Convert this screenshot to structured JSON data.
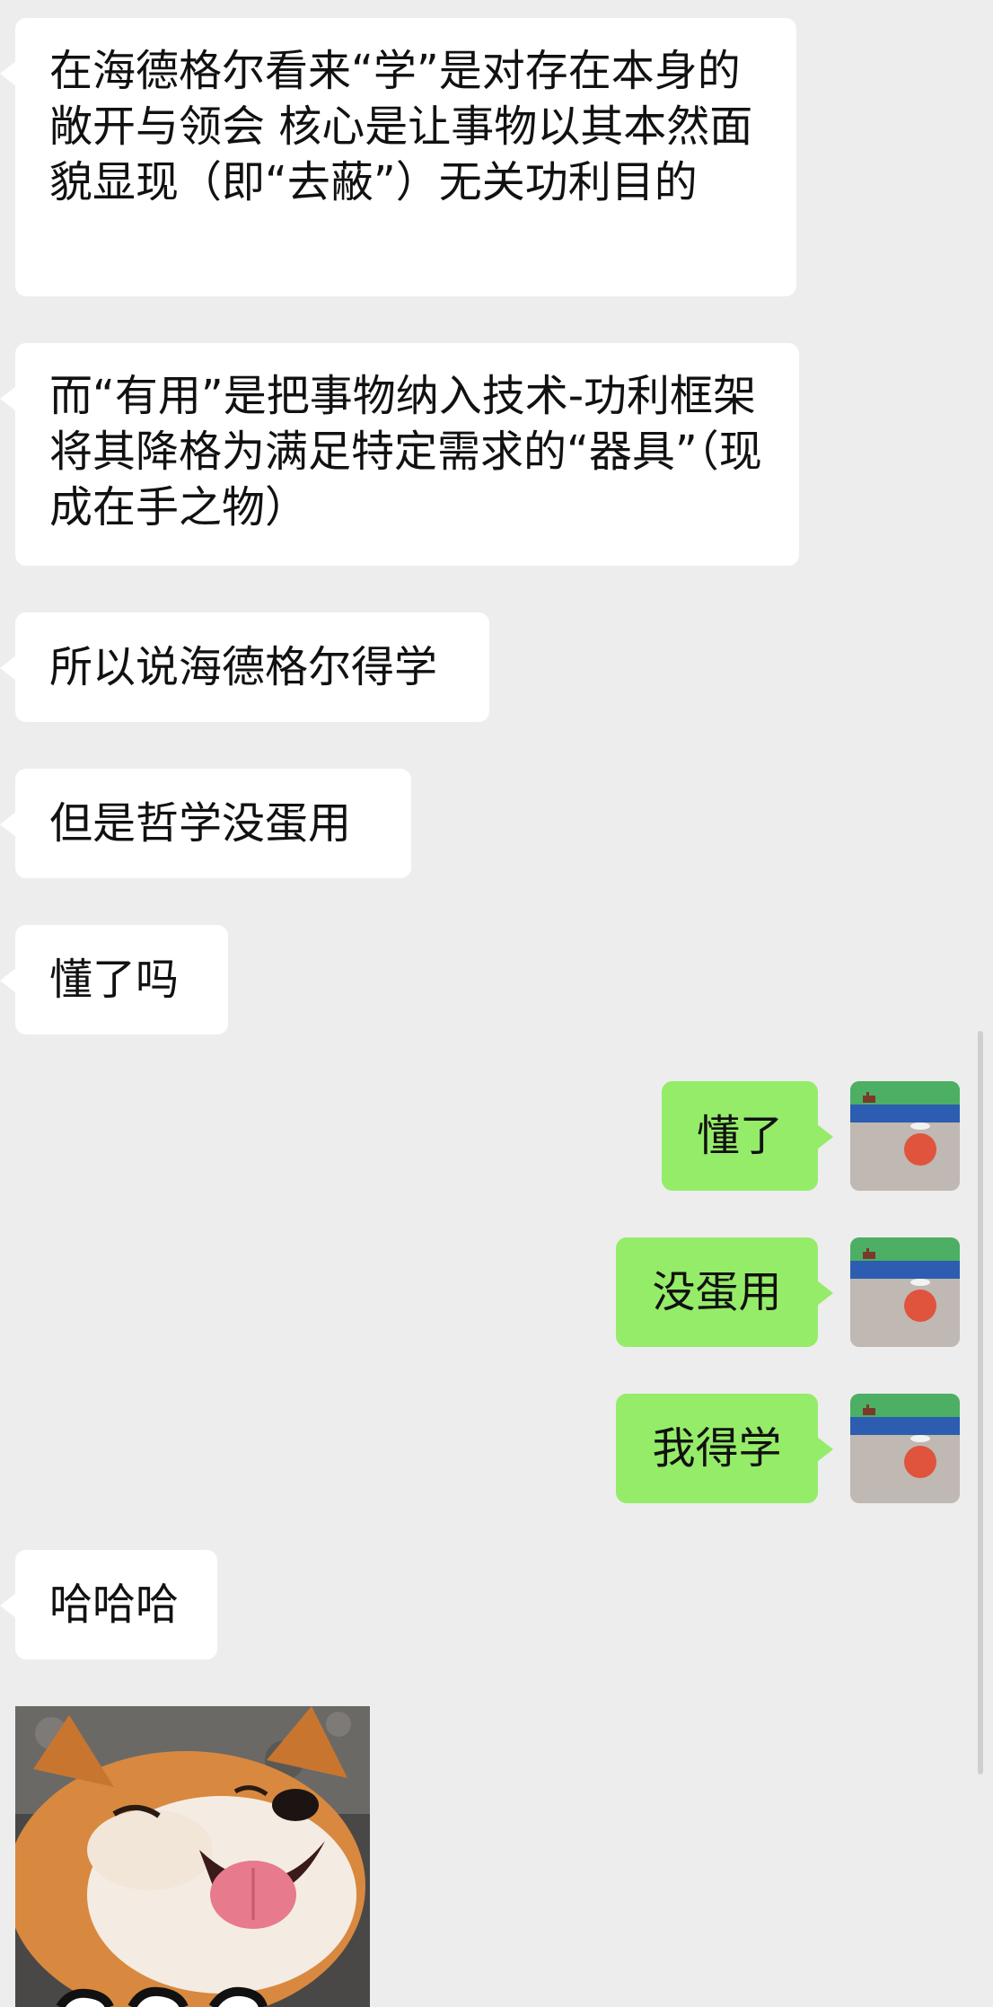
{
  "messages": [
    {
      "sender": "other",
      "text": "在海德格尔看来“学”是对存在本身的敞开与领会 核心是让事物以其本然面貌显现（即“去蔽”）无关功利目的"
    },
    {
      "sender": "other",
      "text": "而“有用”是把事物纳入技术-功利框架 将其降格为满足特定需求的“器具”（现成在手之物）"
    },
    {
      "sender": "other",
      "text": "所以说海德格尔得学"
    },
    {
      "sender": "other",
      "text": "但是哲学没蛋用"
    },
    {
      "sender": "other",
      "text": "懂了吗"
    },
    {
      "sender": "self",
      "text": "懂了"
    },
    {
      "sender": "self",
      "text": "没蛋用"
    },
    {
      "sender": "self",
      "text": "我得学"
    },
    {
      "sender": "other",
      "text": "哈哈哈"
    }
  ],
  "sticker": {
    "icon": "shiba-dog-laughing-sticker"
  },
  "colors": {
    "background": "#ededed",
    "incoming_bubble": "#ffffff",
    "outgoing_bubble": "#95ec69"
  }
}
